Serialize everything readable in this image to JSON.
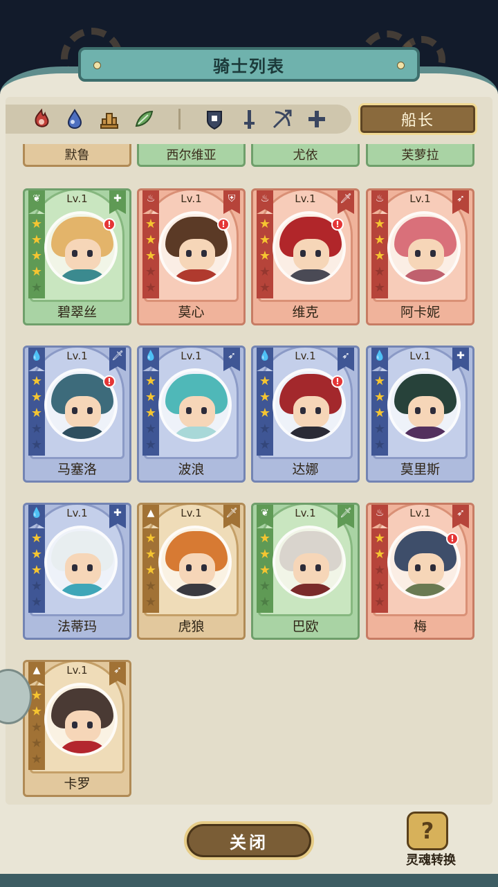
{
  "header": {
    "title": "骑士列表"
  },
  "filters": {
    "elements": [
      {
        "icon": "fire-element-icon",
        "color": "#c2413a"
      },
      {
        "icon": "water-element-icon",
        "color": "#3e5fa8"
      },
      {
        "icon": "earth-element-icon",
        "color": "#b5833a"
      },
      {
        "icon": "wind-element-icon",
        "color": "#5f9a55"
      }
    ],
    "classes": [
      {
        "icon": "shield-class-icon"
      },
      {
        "icon": "sword-class-icon"
      },
      {
        "icon": "bow-class-icon"
      },
      {
        "icon": "cross-class-icon"
      }
    ]
  },
  "captain_button": {
    "label": "船长"
  },
  "top_row_names": [
    "默鲁",
    "西尔维亚",
    "尤依",
    "芙萝拉"
  ],
  "knights": [
    {
      "name": "碧翠丝",
      "level": "Lv.1",
      "theme": "green",
      "class_glyph": "✚",
      "stars": 4,
      "alert": true,
      "hair": "#e3b46a",
      "body": "#3b8a8f"
    },
    {
      "name": "莫心",
      "level": "Lv.1",
      "theme": "red",
      "class_glyph": "⛨",
      "stars": 3,
      "alert": true,
      "hair": "#5b3a26",
      "body": "#b03a2e"
    },
    {
      "name": "维克",
      "level": "Lv.1",
      "theme": "red",
      "class_glyph": "🗡",
      "stars": 3,
      "alert": true,
      "hair": "#b1262a",
      "body": "#4a4a55"
    },
    {
      "name": "阿卡妮",
      "level": "Lv.1",
      "theme": "red",
      "class_glyph": "➶",
      "stars": 3,
      "alert": false,
      "hair": "#d9707a",
      "body": "#c0616e"
    },
    {
      "name": "马塞洛",
      "level": "Lv.1",
      "theme": "blue",
      "class_glyph": "🗡",
      "stars": 3,
      "alert": true,
      "hair": "#3d6b7b",
      "body": "#2f4f5f"
    },
    {
      "name": "波浪",
      "level": "Lv.1",
      "theme": "blue",
      "class_glyph": "➶",
      "stars": 3,
      "alert": false,
      "hair": "#4fb8b8",
      "body": "#a8d8d8"
    },
    {
      "name": "达娜",
      "level": "Lv.1",
      "theme": "blue",
      "class_glyph": "➶",
      "stars": 3,
      "alert": true,
      "hair": "#a3282c",
      "body": "#2b2b36"
    },
    {
      "name": "莫里斯",
      "level": "Lv.1",
      "theme": "blue",
      "class_glyph": "✚",
      "stars": 3,
      "alert": false,
      "hair": "#27423a",
      "body": "#53305e"
    },
    {
      "name": "法蒂玛",
      "level": "Lv.1",
      "theme": "blue",
      "class_glyph": "✚",
      "stars": 3,
      "alert": false,
      "hair": "#e8eef0",
      "body": "#3fa6b8"
    },
    {
      "name": "虎狼",
      "level": "Lv.1",
      "theme": "gold",
      "class_glyph": "🗡",
      "stars": 3,
      "alert": false,
      "hair": "#d77a33",
      "body": "#3a3a40"
    },
    {
      "name": "巴欧",
      "level": "Lv.1",
      "theme": "green",
      "class_glyph": "🗡",
      "stars": 3,
      "alert": false,
      "hair": "#d9d4cd",
      "body": "#7a2a2a"
    },
    {
      "name": "梅",
      "level": "Lv.1",
      "theme": "red",
      "class_glyph": "➶",
      "stars": 2,
      "alert": true,
      "hair": "#3e4e6a",
      "body": "#6a7a52"
    },
    {
      "name": "卡罗",
      "level": "Lv.1",
      "theme": "gold",
      "class_glyph": "➶",
      "stars": 2,
      "alert": false,
      "hair": "#4a3a34",
      "body": "#b3262e"
    }
  ],
  "close_button": {
    "label": "关闭"
  },
  "soul_convert": {
    "label": "灵魂转换",
    "icon": "question-mark-icon",
    "glyph": "?"
  }
}
